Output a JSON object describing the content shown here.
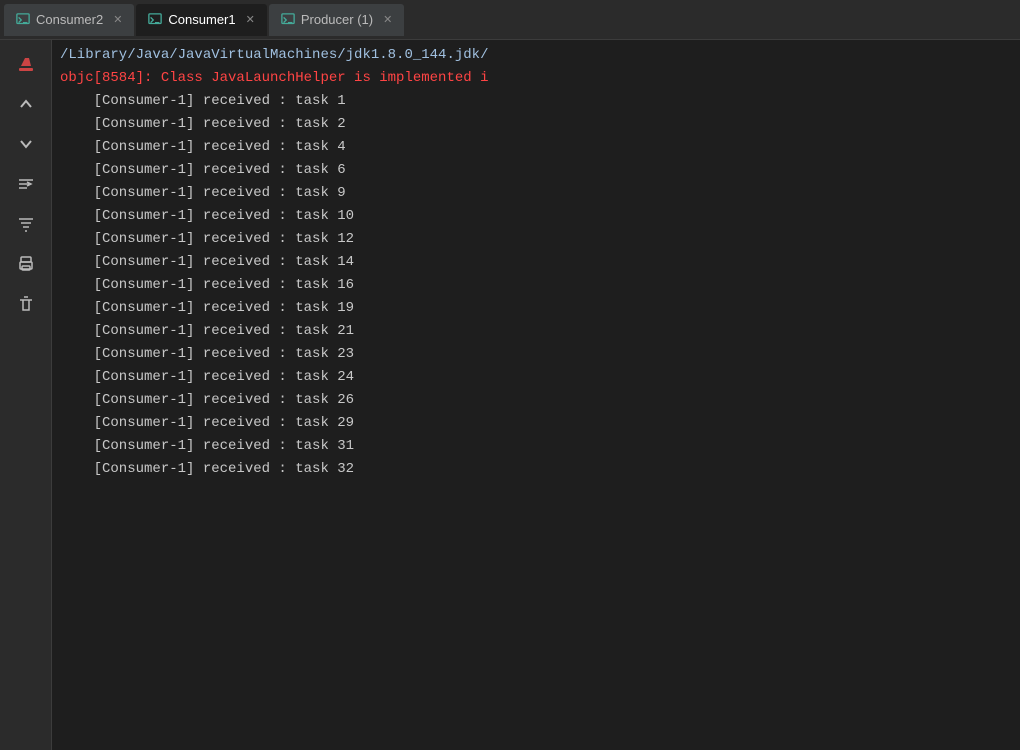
{
  "tabs": [
    {
      "label": "Consumer2",
      "active": false,
      "icon": "console-icon"
    },
    {
      "label": "Consumer1",
      "active": true,
      "icon": "console-icon"
    },
    {
      "label": "Producer (1)",
      "active": false,
      "icon": "console-icon"
    }
  ],
  "sidebar": {
    "buttons": [
      {
        "name": "clear-button",
        "icon": "✏",
        "label": "Clear"
      },
      {
        "name": "scroll-up-button",
        "icon": "↑",
        "label": "Scroll Up"
      },
      {
        "name": "scroll-down-button",
        "icon": "↓",
        "label": "Scroll Down"
      },
      {
        "name": "wrap-button",
        "icon": "⇌",
        "label": "Wrap"
      },
      {
        "name": "filter-button",
        "icon": "≛",
        "label": "Filter"
      },
      {
        "name": "print-button",
        "icon": "⎙",
        "label": "Print"
      },
      {
        "name": "delete-button",
        "icon": "🗑",
        "label": "Delete"
      }
    ]
  },
  "console": {
    "path_line": "/Library/Java/JavaVirtualMachines/jdk1.8.0_144.jdk/",
    "error_line": "objc[8584]: Class JavaLaunchHelper is implemented i",
    "log_lines": [
      "[Consumer-1] received : task 1",
      "[Consumer-1] received : task 2",
      "[Consumer-1] received : task 4",
      "[Consumer-1] received : task 6",
      "[Consumer-1] received : task 9",
      "[Consumer-1] received : task 10",
      "[Consumer-1] received : task 12",
      "[Consumer-1] received : task 14",
      "[Consumer-1] received : task 16",
      "[Consumer-1] received : task 19",
      "[Consumer-1] received : task 21",
      "[Consumer-1] received : task 23",
      "[Consumer-1] received : task 24",
      "[Consumer-1] received : task 26",
      "[Consumer-1] received : task 29",
      "[Consumer-1] received : task 31",
      "[Consumer-1] received : task 32"
    ]
  }
}
